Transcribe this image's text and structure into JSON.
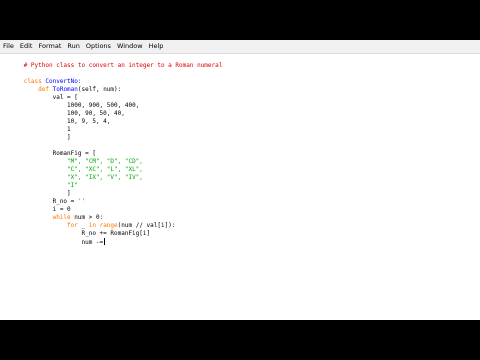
{
  "menu": [
    "File",
    "Edit",
    "Format",
    "Run",
    "Options",
    "Window",
    "Help"
  ],
  "code": {
    "comment": "# Python class to convert an integer to a Roman numeral",
    "class_kw": "class",
    "class_name": "ConvertNo:",
    "def_kw": "def",
    "def_name": "ToRoman",
    "def_params": "(self, num):",
    "val_assign": "val = [",
    "val_row1": "1000, 900, 500, 400,",
    "val_row2": "100, 90, 50, 40,",
    "val_row3": "10, 9, 5, 4,",
    "val_row4": "1",
    "close_bracket": "]",
    "romanfig_assign": "RomanFig = [",
    "rf_row1": "\"M\", \"CM\", \"D\", \"CD\",",
    "rf_row2": "\"C\", \"XC\", \"L\", \"XL\",",
    "rf_row3": "\"X\", \"IX\", \"V\", \"IV\",",
    "rf_row4": "\"I\"",
    "close_bracket2": "]",
    "rno_name": "R_no = ",
    "rno_value": "''",
    "i_assign": "i = 0",
    "while_kw": "while",
    "while_cond": " num > 0:",
    "for_kw": "for",
    "for_var": " _ ",
    "in_kw": "in",
    "range_fn": " range",
    "range_args": "(num // val[i]):",
    "rno_update": "R_no += RomanFig[i]",
    "num_update": "num -="
  }
}
